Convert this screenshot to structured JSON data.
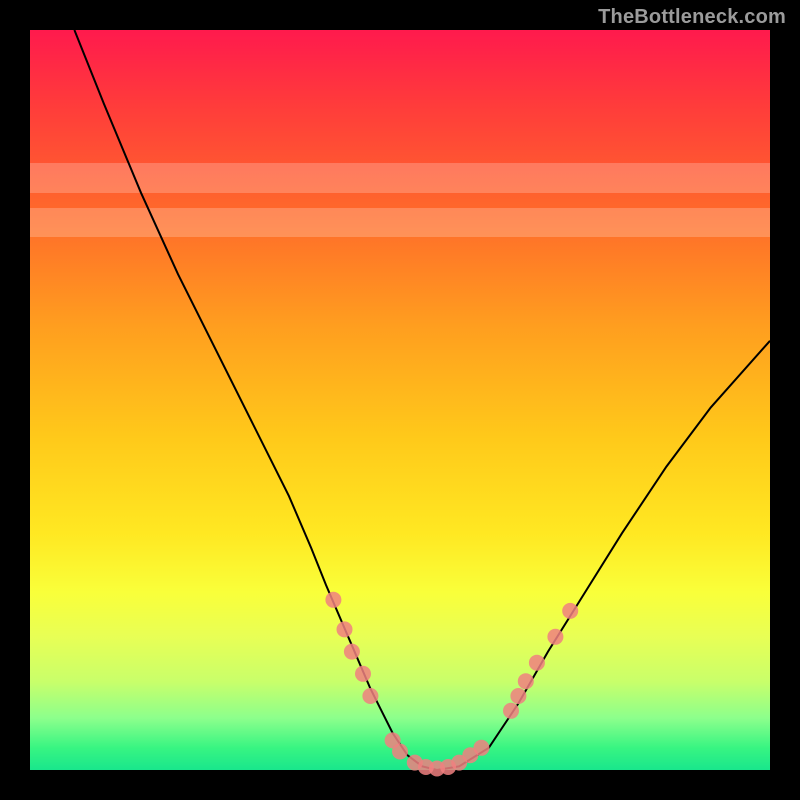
{
  "watermark": "TheBottleneck.com",
  "chart_data": {
    "type": "line",
    "title": "",
    "xlabel": "",
    "ylabel": "",
    "xlim": [
      0,
      100
    ],
    "ylim": [
      0,
      100
    ],
    "legend": false,
    "grid": false,
    "background_gradient": {
      "direction": "vertical",
      "stops": [
        {
          "pos": 0.0,
          "color": "#ff1a4d"
        },
        {
          "pos": 0.1,
          "color": "#ff3b3b"
        },
        {
          "pos": 0.25,
          "color": "#ff6a2a"
        },
        {
          "pos": 0.4,
          "color": "#ff9e1f"
        },
        {
          "pos": 0.55,
          "color": "#ffc91a"
        },
        {
          "pos": 0.68,
          "color": "#ffe822"
        },
        {
          "pos": 0.76,
          "color": "#f9ff3a"
        },
        {
          "pos": 0.82,
          "color": "#e8ff55"
        },
        {
          "pos": 0.88,
          "color": "#c9ff6a"
        },
        {
          "pos": 0.93,
          "color": "#8cff8c"
        },
        {
          "pos": 0.97,
          "color": "#38f582"
        },
        {
          "pos": 1.0,
          "color": "#19e68c"
        }
      ]
    },
    "horizontal_bands": [
      {
        "y_from": 72,
        "y_to": 76,
        "alpha": 0.22
      },
      {
        "y_from": 78,
        "y_to": 82,
        "alpha": 0.22
      }
    ],
    "series": [
      {
        "name": "bottleneck-curve",
        "style": "line",
        "color": "#000000",
        "width": 2,
        "x": [
          6,
          10,
          15,
          20,
          25,
          30,
          35,
          38,
          40,
          43,
          46,
          49,
          51,
          53,
          55,
          58,
          62,
          66,
          70,
          75,
          80,
          86,
          92,
          100
        ],
        "y": [
          100,
          90,
          78,
          67,
          57,
          47,
          37,
          30,
          25,
          18,
          11,
          5,
          2,
          0.5,
          0,
          0.5,
          3,
          9,
          16,
          24,
          32,
          41,
          49,
          58
        ]
      }
    ],
    "markers": {
      "name": "highlight-dots",
      "color": "#f08080",
      "radius": 8,
      "points": [
        {
          "x": 41,
          "y": 23
        },
        {
          "x": 42.5,
          "y": 19
        },
        {
          "x": 43.5,
          "y": 16
        },
        {
          "x": 45,
          "y": 13
        },
        {
          "x": 46,
          "y": 10
        },
        {
          "x": 49,
          "y": 4
        },
        {
          "x": 50,
          "y": 2.5
        },
        {
          "x": 52,
          "y": 1
        },
        {
          "x": 53.5,
          "y": 0.4
        },
        {
          "x": 55,
          "y": 0.2
        },
        {
          "x": 56.5,
          "y": 0.4
        },
        {
          "x": 58,
          "y": 1
        },
        {
          "x": 59.5,
          "y": 2
        },
        {
          "x": 61,
          "y": 3
        },
        {
          "x": 65,
          "y": 8
        },
        {
          "x": 66,
          "y": 10
        },
        {
          "x": 67,
          "y": 12
        },
        {
          "x": 68.5,
          "y": 14.5
        },
        {
          "x": 71,
          "y": 18
        },
        {
          "x": 73,
          "y": 21.5
        }
      ]
    }
  }
}
